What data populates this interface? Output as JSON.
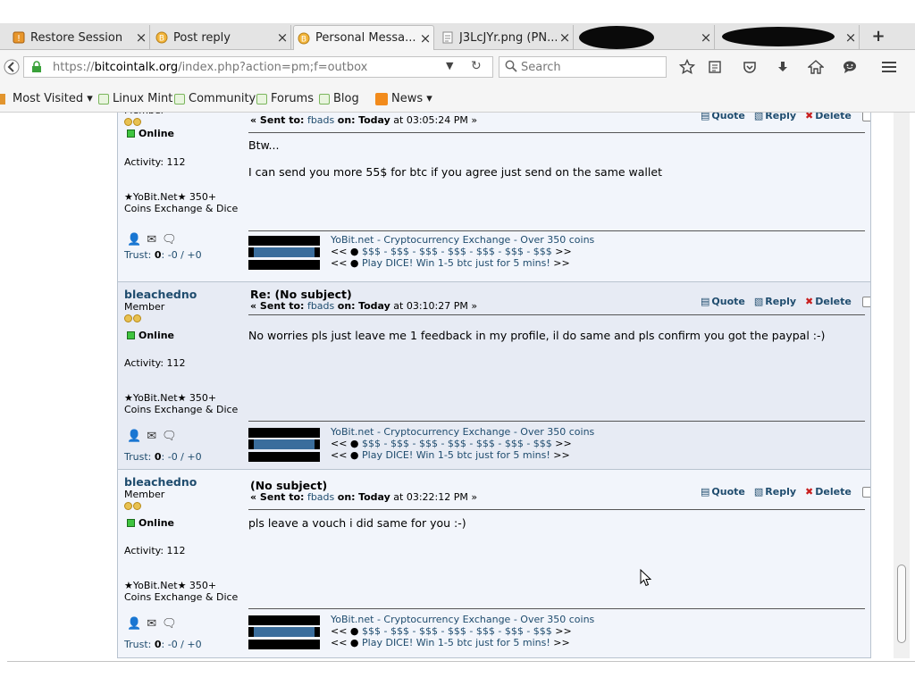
{
  "tabs": [
    {
      "label": "Restore Session",
      "icon": "restore-session-icon",
      "active": false
    },
    {
      "label": "Post reply",
      "icon": "bitcoin-favicon",
      "active": false
    },
    {
      "label": "Personal Messa...",
      "icon": "bitcoin-favicon",
      "active": true
    },
    {
      "label": "J3LcJYr.png (PN...",
      "icon": "image-file-icon",
      "active": false
    },
    {
      "label": "",
      "icon": "redacted",
      "active": false
    },
    {
      "label": "",
      "icon": "redacted",
      "active": false
    }
  ],
  "tab_close_glyph": "×",
  "new_tab_glyph": "+",
  "url": {
    "prefix": "https://",
    "host": "bitcointalk.org",
    "path": "/index.php?action=pm;f=outbox"
  },
  "search_placeholder": "Search",
  "bookmarks": [
    {
      "label": "Most Visited ▾"
    },
    {
      "label": "Linux Mint"
    },
    {
      "label": "Community"
    },
    {
      "label": "Forums"
    },
    {
      "label": "Blog"
    },
    {
      "label": "News ▾"
    }
  ],
  "actions": {
    "quote": "Quote",
    "reply": "Reply",
    "delete": "Delete"
  },
  "poster": {
    "name": "bleachedno",
    "rank": "Member",
    "status": "Online",
    "activity": "Activity: 112",
    "personal_text": "★YoBit.Net★ 350+ Coins Exchange & Dice",
    "trust_label": "Trust:",
    "trust_score": "0",
    "trust_rest": ": -0 / +0"
  },
  "signature": {
    "line1": "YoBit.net - Cryptocurrency Exchange - Over 350 coins",
    "line2_pre": "<< ●",
    "line2_link": "$$$ - $$$ - $$$ - $$$ - $$$ - $$$ - $$$",
    "line2_post": ">>",
    "line3_pre": "<< ●",
    "line3_link": "Play DICE! Win 1-5 btc just for 5 mins!",
    "line3_post": ">>"
  },
  "posts": [
    {
      "subject": "",
      "sent_to_label": "« Sent to:",
      "recipient": "fbads",
      "on_label": "on:",
      "date": "Today",
      "time": "at 03:05:24 PM »",
      "body_lines": [
        "Btw...",
        "I can send you more 55$ for btc if you agree just send on the same wallet"
      ]
    },
    {
      "subject": "Re: (No subject)",
      "sent_to_label": "« Sent to:",
      "recipient": "fbads",
      "on_label": "on:",
      "date": "Today",
      "time": "at 03:10:27 PM »",
      "body_lines": [
        "No worries pls just leave me 1 feedback in my profile, il do same and pls confirm you got the paypal :-)"
      ]
    },
    {
      "subject": "(No subject)",
      "sent_to_label": "« Sent to:",
      "recipient": "fbads",
      "on_label": "on:",
      "date": "Today",
      "time": "at 03:22:12 PM »",
      "body_lines": [
        "pls leave a vouch i did same for you :-)"
      ]
    }
  ]
}
